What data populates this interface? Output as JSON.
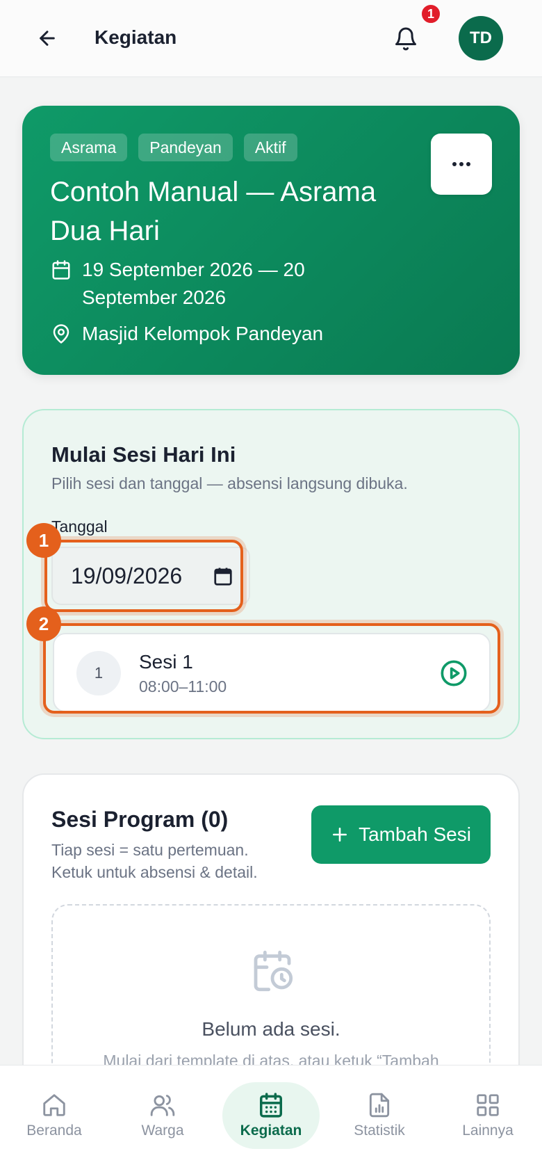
{
  "header": {
    "title": "Kegiatan",
    "notification_count": "1",
    "avatar_initials": "TD"
  },
  "hero": {
    "tags": [
      "Asrama",
      "Pandeyan",
      "Aktif"
    ],
    "title": "Contoh Manual — Asrama Dua Hari",
    "date_range": "19 September 2026 — 20 September 2026",
    "location": "Masjid Kelompok Pandeyan"
  },
  "start_session": {
    "title": "Mulai Sesi Hari Ini",
    "subtitle": "Pilih sesi dan tanggal — absensi langsung dibuka.",
    "date_label": "Tanggal",
    "date_value": "19/09/2026",
    "marker_1": "1",
    "marker_2": "2",
    "session": {
      "number": "1",
      "name": "Sesi 1",
      "time": "08:00–11:00"
    }
  },
  "program": {
    "title": "Sesi Program (0)",
    "subtitle": "Tiap sesi = satu pertemuan. Ketuk untuk absensi & detail.",
    "add_button": "Tambah Sesi",
    "empty_title": "Belum ada sesi.",
    "empty_subtitle": "Mulai dari template di atas, atau ketuk “Tambah"
  },
  "nav": {
    "items": [
      {
        "label": "Beranda",
        "icon": "home-icon"
      },
      {
        "label": "Warga",
        "icon": "users-icon"
      },
      {
        "label": "Kegiatan",
        "icon": "calendar-icon",
        "active": true
      },
      {
        "label": "Statistik",
        "icon": "report-chart-icon"
      },
      {
        "label": "Lainnya",
        "icon": "grid-icon"
      }
    ]
  },
  "colors": {
    "brand": "#0f9a68",
    "brand_dark": "#0b6b4c",
    "highlight": "#e4601c",
    "badge": "#e11d2a"
  }
}
